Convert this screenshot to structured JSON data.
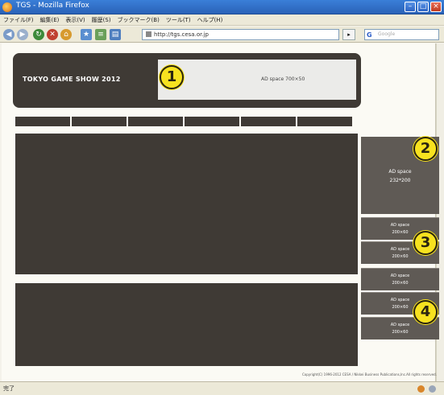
{
  "browser": {
    "window_title": "TGS - Mozilla Firefox",
    "menu": [
      "ファイル(F)",
      "編集(E)",
      "表示(V)",
      "履歴(S)",
      "ブックマーク(B)",
      "ツール(T)",
      "ヘルプ(H)"
    ],
    "url": "http://tgs.cesa.or.jp",
    "search_placeholder": "Google",
    "status": "完了"
  },
  "header": {
    "title": "TOKYO GAME SHOW 2012",
    "ad_text": "AD space  700×50"
  },
  "badges": [
    "1",
    "2",
    "3",
    "4"
  ],
  "nav": {
    "tabs": [
      "",
      "",
      "",
      "",
      "",
      ""
    ]
  },
  "sidebar": {
    "big_ad": {
      "line1": "AD space",
      "line2": "232*200"
    },
    "small_ads": [
      {
        "line1": "AD space",
        "line2": "200×60"
      },
      {
        "line1": "AD space",
        "line2": "200×60"
      },
      {
        "line1": "AD space",
        "line2": "200×60"
      },
      {
        "line1": "AD space",
        "line2": "200×60"
      },
      {
        "line1": "AD space",
        "line2": "200×60"
      }
    ]
  },
  "footer": {
    "copyright": "Copyright(C) 1996-2012 CESA / Nikkei Business Publications,Inc.All rights reserved."
  },
  "colors": {
    "block_dark": "#3f3a35",
    "sidebar": "#5f5a55",
    "badge": "#f7e21f"
  }
}
